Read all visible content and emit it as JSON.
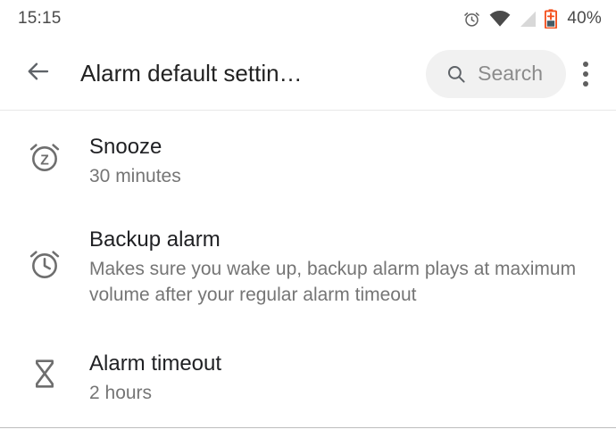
{
  "status_bar": {
    "time": "15:15",
    "battery_percent": "40%",
    "icons": [
      {
        "name": "alarm-clock-icon",
        "color": "#5f5f5f"
      },
      {
        "name": "wifi-icon",
        "color": "#4a4a4a"
      },
      {
        "name": "cellular-signal-icon",
        "color": "#d0d0d0"
      },
      {
        "name": "battery-charging-icon",
        "color": "#f4511e"
      }
    ]
  },
  "app_bar": {
    "back_label": "back-arrow",
    "title": "Alarm default settin…",
    "search_placeholder": "Search",
    "overflow_label": "more-options"
  },
  "list": {
    "items": [
      {
        "id": "snooze",
        "icon": "snooze-alarm-icon",
        "title": "Snooze",
        "subtitle": "30 minutes"
      },
      {
        "id": "backup",
        "icon": "alarm-clock-icon",
        "title": "Backup alarm",
        "subtitle": "Makes sure you wake up, backup alarm plays at maximum volume after your regular alarm timeout"
      },
      {
        "id": "timeout",
        "icon": "hourglass-icon",
        "title": "Alarm timeout",
        "subtitle": "2 hours"
      }
    ]
  },
  "colors": {
    "title_text": "#202124",
    "subtitle_text": "#757575",
    "icon_gray": "#6e6e6e",
    "search_bg": "#f1f1f1",
    "battery_orange": "#f4511e"
  }
}
